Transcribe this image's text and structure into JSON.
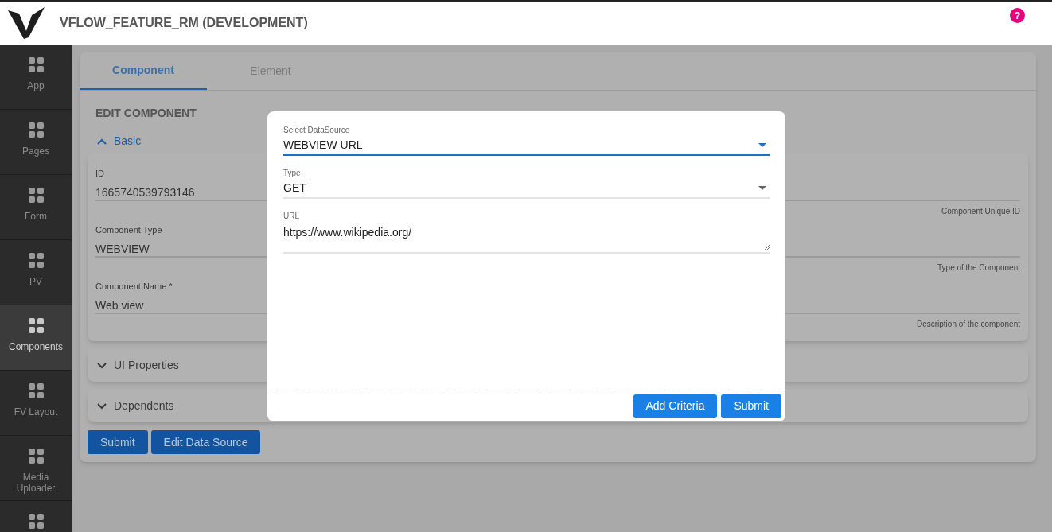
{
  "header": {
    "title": "VFLOW_FEATURE_RM (DEVELOPMENT)",
    "help": "?"
  },
  "sidebar": {
    "items": [
      {
        "label": "App",
        "selected": false
      },
      {
        "label": "Pages",
        "selected": false
      },
      {
        "label": "Form",
        "selected": false
      },
      {
        "label": "PV",
        "selected": false
      },
      {
        "label": "Components",
        "selected": true
      },
      {
        "label": "FV Layout",
        "selected": false
      },
      {
        "label": "Media Uploader",
        "selected": false
      },
      {
        "selected": false
      }
    ]
  },
  "tabs": [
    {
      "label": "Component",
      "selected": true
    },
    {
      "label": "Element",
      "selected": false
    }
  ],
  "section_title": "EDIT COMPONENT",
  "basic": {
    "title": "Basic",
    "expanded": true,
    "fields": [
      {
        "label": "ID",
        "value": "1665740539793146",
        "helper": "Component Unique ID"
      },
      {
        "label": "Component Type",
        "value": "WEBVIEW",
        "helper": "Type of the Component"
      },
      {
        "label": "Component Name *",
        "value": "Web view",
        "helper": "Description of the component"
      }
    ]
  },
  "sections": [
    {
      "title": "UI Properties",
      "expanded": false
    },
    {
      "title": "Dependents",
      "expanded": false
    }
  ],
  "buttons": [
    "Submit",
    "Edit Data Source"
  ],
  "dialog": {
    "fields": [
      {
        "kind": "select",
        "label": "Select DataSource",
        "value": "WEBVIEW URL",
        "focused": true
      },
      {
        "kind": "select",
        "label": "Type",
        "value": "GET",
        "focused": false
      },
      {
        "kind": "textarea",
        "label": "URL",
        "value": "https://www.wikipedia.org/",
        "focused": false
      }
    ],
    "buttons": [
      "Add Criteria",
      "Submit"
    ]
  }
}
